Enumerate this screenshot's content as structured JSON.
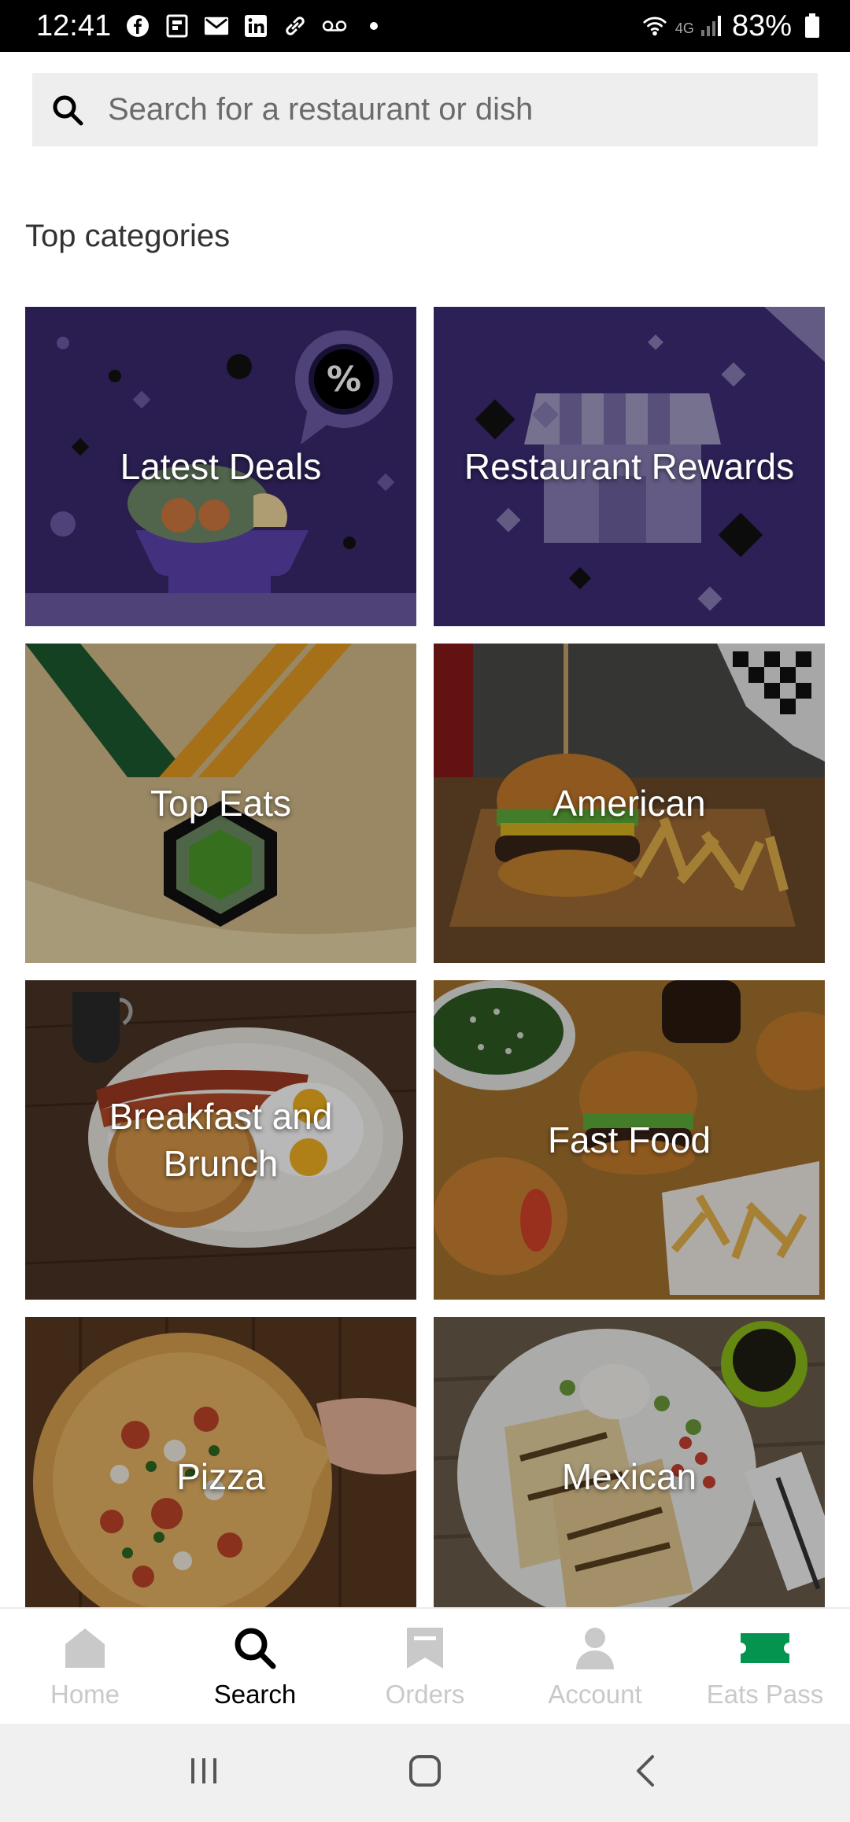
{
  "status_bar": {
    "time": "12:41",
    "network": "4G",
    "battery": "83%",
    "icons": [
      "facebook-icon",
      "flipboard-icon",
      "mail-icon",
      "linkedin-icon",
      "link-icon",
      "voicemail-icon",
      "dot-icon",
      "wifi-icon",
      "signal-icon",
      "battery-icon"
    ]
  },
  "search": {
    "placeholder": "Search for a restaurant or dish"
  },
  "section": {
    "title": "Top categories"
  },
  "categories": [
    {
      "label": "Latest Deals"
    },
    {
      "label": "Restaurant Rewards"
    },
    {
      "label": "Top Eats"
    },
    {
      "label": "American"
    },
    {
      "label": "Breakfast and Brunch"
    },
    {
      "label": "Fast Food"
    },
    {
      "label": "Pizza"
    },
    {
      "label": "Mexican"
    }
  ],
  "bottom_nav": [
    {
      "label": "Home",
      "icon": "home-icon"
    },
    {
      "label": "Search",
      "icon": "search-icon",
      "active": true
    },
    {
      "label": "Orders",
      "icon": "orders-icon"
    },
    {
      "label": "Account",
      "icon": "account-icon"
    },
    {
      "label": "Eats Pass",
      "icon": "ticket-icon",
      "accent": "#05944f"
    }
  ],
  "colors": {
    "deals_bg": "#3a2a6e",
    "rewards_bg": "#3d2d78",
    "eats_pass": "#05944f"
  }
}
